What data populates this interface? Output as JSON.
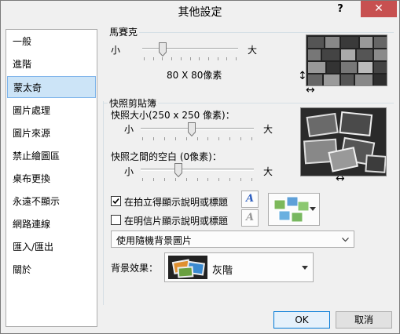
{
  "window": {
    "title": "其他設定",
    "help": "?",
    "close": "✕"
  },
  "sidebar": {
    "items": [
      {
        "label": "一般"
      },
      {
        "label": "進階"
      },
      {
        "label": "蒙太奇"
      },
      {
        "label": "圖片處理"
      },
      {
        "label": "圖片來源"
      },
      {
        "label": "禁止繪圖區"
      },
      {
        "label": "桌布更換"
      },
      {
        "label": "永遠不顯示"
      },
      {
        "label": "網路連線"
      },
      {
        "label": "匯入/匯出"
      },
      {
        "label": "關於"
      }
    ],
    "selected_index": 2
  },
  "mosaic": {
    "group_label": "馬賽克",
    "small": "小",
    "large": "大",
    "size_value": "80 X 80像素",
    "slider_level": 0.2
  },
  "snapshot": {
    "group_label": "快照剪貼簿",
    "size_label": "快照大小(250 x 250 像素)：",
    "size_small": "小",
    "size_large": "大",
    "size_level": 0.45,
    "gap_label": "快照之間的空白 (0像素)：",
    "gap_small": "小",
    "gap_large": "大",
    "gap_level": 0.33,
    "check1_label": "在拍立得顯示說明或標題",
    "check1_checked": true,
    "check2_label": "在明信片顯示說明或標題",
    "check2_checked": false,
    "font_icon": "A",
    "background_select": "使用隨機背景圖片",
    "effect_label": "背景效果：",
    "effect_value": "灰階"
  },
  "buttons": {
    "ok": "OK",
    "cancel": "取消"
  }
}
